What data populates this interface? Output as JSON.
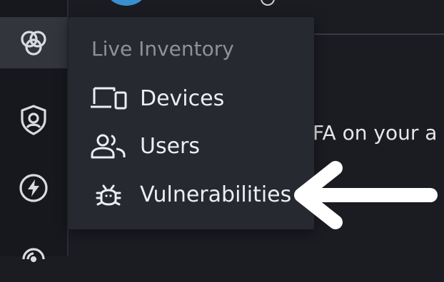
{
  "sidebar": {
    "items": [
      {
        "icon": "overlapping-circles-icon",
        "active": true
      },
      {
        "icon": "shield-person-icon",
        "active": false
      },
      {
        "icon": "lightning-bolt-icon",
        "active": false
      },
      {
        "icon": "radar-icon",
        "active": false
      }
    ]
  },
  "background": {
    "body_text": "FA on your a"
  },
  "flyout": {
    "title": "Live Inventory",
    "items": [
      {
        "label": "Devices",
        "icon": "devices-icon"
      },
      {
        "label": "Users",
        "icon": "users-icon"
      },
      {
        "label": "Vulnerabilities",
        "icon": "bug-icon"
      }
    ]
  },
  "annotation": {
    "arrow_color": "#ffffff",
    "points_to": "Vulnerabilities"
  },
  "colors": {
    "sidebar_bg": "#17181d",
    "active_item_bg": "#33353d",
    "menu_bg": "#272930",
    "menu_title": "#8e919a",
    "menu_text": "#eceef1",
    "avatar": "#3a8fd1"
  }
}
